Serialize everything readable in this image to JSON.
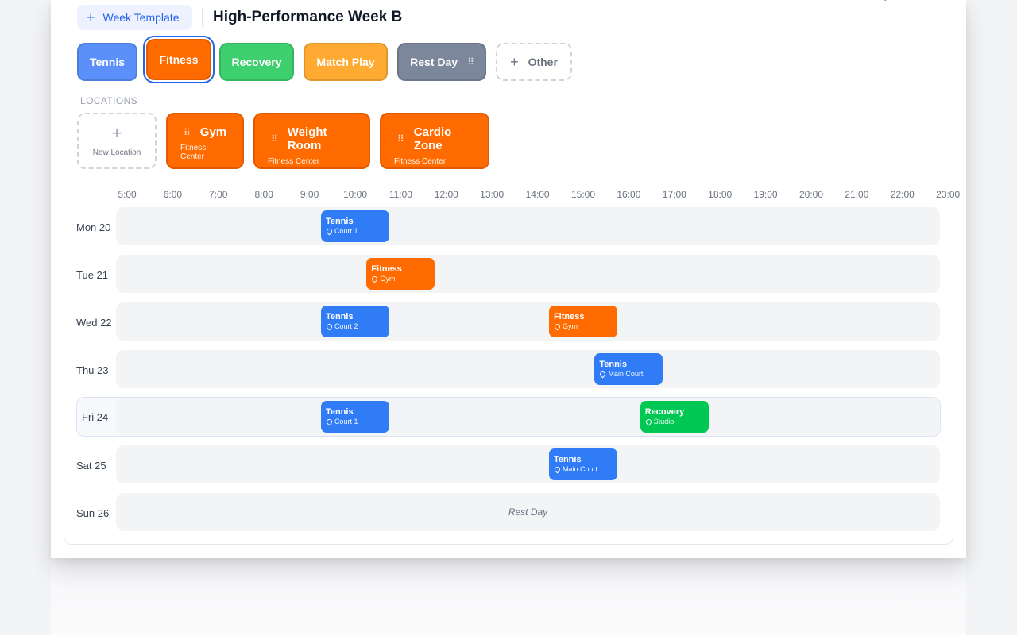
{
  "header": {
    "week_template_label": "Week Template",
    "title": "High-Performance Week B"
  },
  "activities": [
    {
      "label": "Tennis",
      "color": "#5b8ff9",
      "selected": false,
      "draggable": false
    },
    {
      "label": "Fitness",
      "color": "#ff6b00",
      "selected": true,
      "draggable": false
    },
    {
      "label": "Recovery",
      "color": "#3ecf6e",
      "selected": false,
      "draggable": false
    },
    {
      "label": "Match Play",
      "color": "#ffaa33",
      "selected": false,
      "draggable": false
    },
    {
      "label": "Rest Day",
      "color": "#7c879c",
      "selected": false,
      "draggable": true
    }
  ],
  "other_label": "Other",
  "locations_section": {
    "label": "LOCATIONS",
    "new_location_label": "New Location",
    "items": [
      {
        "name": "Gym",
        "parent": "Fitness Center"
      },
      {
        "name": "Weight Room",
        "parent": "Fitness Center"
      },
      {
        "name": "Cardio Zone",
        "parent": "Fitness Center"
      }
    ]
  },
  "timeline": {
    "hours": [
      "5:00",
      "6:00",
      "7:00",
      "8:00",
      "9:00",
      "10:00",
      "11:00",
      "12:00",
      "13:00",
      "14:00",
      "15:00",
      "16:00",
      "17:00",
      "18:00",
      "19:00",
      "20:00",
      "21:00",
      "22:00",
      "23:00"
    ],
    "days": [
      {
        "label": "Mon 20",
        "highlight": false,
        "events": [
          {
            "title": "Tennis",
            "location": "Court 1",
            "start": "9:15",
            "end": "10:45",
            "color": "#2f7cf6"
          }
        ]
      },
      {
        "label": "Tue 21",
        "highlight": false,
        "events": [
          {
            "title": "Fitness",
            "location": "Gym",
            "start": "10:15",
            "end": "11:45",
            "color": "#ff6b00"
          }
        ]
      },
      {
        "label": "Wed 22",
        "highlight": false,
        "events": [
          {
            "title": "Tennis",
            "location": "Court 2",
            "start": "9:15",
            "end": "10:45",
            "color": "#2f7cf6"
          },
          {
            "title": "Fitness",
            "location": "Gym",
            "start": "14:15",
            "end": "15:45",
            "color": "#ff6b00"
          }
        ]
      },
      {
        "label": "Thu 23",
        "highlight": false,
        "events": [
          {
            "title": "Tennis",
            "location": "Main Court",
            "start": "15:15",
            "end": "16:45",
            "color": "#2f7cf6"
          }
        ]
      },
      {
        "label": "Fri 24",
        "highlight": true,
        "events": [
          {
            "title": "Tennis",
            "location": "Court 1",
            "start": "9:15",
            "end": "10:45",
            "color": "#2f7cf6"
          },
          {
            "title": "Recovery",
            "location": "Studio",
            "start": "16:15",
            "end": "17:45",
            "color": "#00c853"
          }
        ]
      },
      {
        "label": "Sat 25",
        "highlight": false,
        "events": [
          {
            "title": "Tennis",
            "location": "Main Court",
            "start": "14:15",
            "end": "15:45",
            "color": "#2f7cf6"
          }
        ]
      },
      {
        "label": "Sun 26",
        "highlight": false,
        "rest_text": "Rest Day",
        "events": []
      }
    ]
  }
}
